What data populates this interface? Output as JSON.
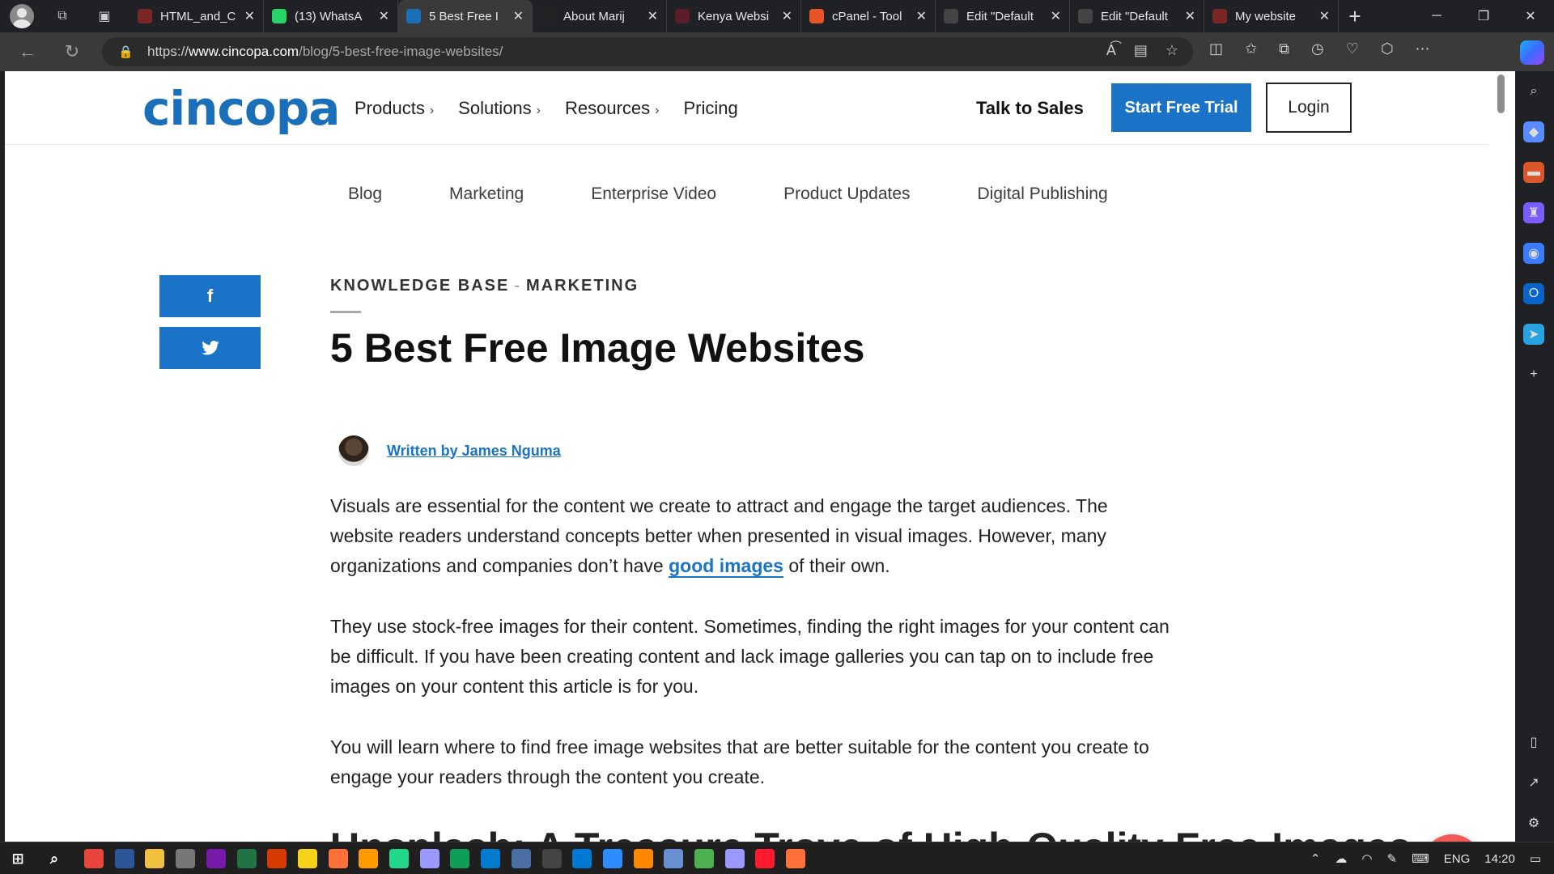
{
  "browser": {
    "tabs": [
      {
        "label": "HTML_and_C",
        "fav_color": "#7a2626",
        "active": false
      },
      {
        "label": "(13) WhatsA",
        "fav_color": "#25d366",
        "active": false
      },
      {
        "label": "5 Best Free I",
        "fav_color": "#1b6fb8",
        "active": true
      },
      {
        "label": "About Marij",
        "fav_color": "#222222",
        "active": false
      },
      {
        "label": "Kenya Websi",
        "fav_color": "#5a1e2a",
        "active": false
      },
      {
        "label": "cPanel - Tool",
        "fav_color": "#e8542a",
        "active": false
      },
      {
        "label": "Edit \"Default",
        "fav_color": "#444444",
        "active": false
      },
      {
        "label": "Edit \"Default",
        "fav_color": "#444444",
        "active": false
      },
      {
        "label": "My website",
        "fav_color": "#7a2626",
        "active": false
      }
    ],
    "url_scheme": "https://",
    "url_host": "www.cincopa.com",
    "url_path": "/blog/5-best-free-image-websites/"
  },
  "site": {
    "logo": "cincopa",
    "nav": [
      {
        "label": "Products",
        "has_chevron": true
      },
      {
        "label": "Solutions",
        "has_chevron": true
      },
      {
        "label": "Resources",
        "has_chevron": true
      },
      {
        "label": "Pricing",
        "has_chevron": false
      }
    ],
    "talk_label": "Talk to Sales",
    "trial_label": "Start Free Trial",
    "login_label": "Login",
    "accent": "#1a73c6"
  },
  "categories": [
    "Blog",
    "Marketing",
    "Enterprise Video",
    "Product Updates",
    "Digital Publishing"
  ],
  "article": {
    "crumb_1": "KNOWLEDGE BASE",
    "crumb_sep": "-",
    "crumb_2": "MARKETING",
    "title": "5 Best Free Image Websites",
    "author": "Written by James Nguma",
    "p1_before": "Visuals are essential for the content we create to attract and engage the target audiences. The website readers understand concepts better when presented in visual images. However, many organizations and companies don’t have ",
    "p1_link": "good images",
    "p1_after": " of their own.",
    "p2": "They use stock-free images for their content. Sometimes, finding the right images for your content can be difficult. If you have been creating content and lack image galleries you can tap on to include free images on your content this article is for you.",
    "p3": "You will learn where to find free image websites that are better suitable for the content you create to engage your readers through the content you create.",
    "next_heading": "Unsplash: A Treasure Trove of High-Quality Free Images"
  },
  "share": {
    "facebook_glyph": "f",
    "twitter_glyph": "🐦"
  },
  "taskbar": {
    "lang": "ENG",
    "time": "14:20"
  }
}
